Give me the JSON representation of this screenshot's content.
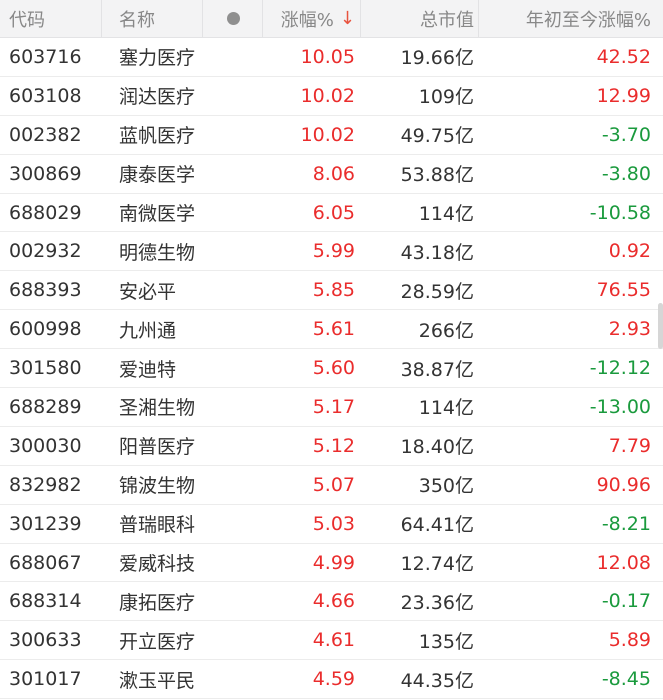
{
  "header": {
    "code": "代码",
    "name": "名称",
    "change": "涨幅%",
    "sort_arrow": "↓",
    "market_cap": "总市值",
    "ytd": "年初至今涨幅%"
  },
  "colors": {
    "up": "#ea2c2c",
    "down": "#1a9a3d",
    "sort_arrow": "#e8533f"
  },
  "rows": [
    {
      "code": "603716",
      "name": "塞力医疗",
      "change": "10.05",
      "cap": "19.66亿",
      "ytd": "42.52",
      "ytd_dir": "up"
    },
    {
      "code": "603108",
      "name": "润达医疗",
      "change": "10.02",
      "cap": "109亿",
      "ytd": "12.99",
      "ytd_dir": "up"
    },
    {
      "code": "002382",
      "name": "蓝帆医疗",
      "change": "10.02",
      "cap": "49.75亿",
      "ytd": "-3.70",
      "ytd_dir": "down"
    },
    {
      "code": "300869",
      "name": "康泰医学",
      "change": "8.06",
      "cap": "53.88亿",
      "ytd": "-3.80",
      "ytd_dir": "down"
    },
    {
      "code": "688029",
      "name": "南微医学",
      "change": "6.05",
      "cap": "114亿",
      "ytd": "-10.58",
      "ytd_dir": "down"
    },
    {
      "code": "002932",
      "name": "明德生物",
      "change": "5.99",
      "cap": "43.18亿",
      "ytd": "0.92",
      "ytd_dir": "up"
    },
    {
      "code": "688393",
      "name": "安必平",
      "change": "5.85",
      "cap": "28.59亿",
      "ytd": "76.55",
      "ytd_dir": "up"
    },
    {
      "code": "600998",
      "name": "九州通",
      "change": "5.61",
      "cap": "266亿",
      "ytd": "2.93",
      "ytd_dir": "up"
    },
    {
      "code": "301580",
      "name": "爱迪特",
      "change": "5.60",
      "cap": "38.87亿",
      "ytd": "-12.12",
      "ytd_dir": "down"
    },
    {
      "code": "688289",
      "name": "圣湘生物",
      "change": "5.17",
      "cap": "114亿",
      "ytd": "-13.00",
      "ytd_dir": "down"
    },
    {
      "code": "300030",
      "name": "阳普医疗",
      "change": "5.12",
      "cap": "18.40亿",
      "ytd": "7.79",
      "ytd_dir": "up"
    },
    {
      "code": "832982",
      "name": "锦波生物",
      "change": "5.07",
      "cap": "350亿",
      "ytd": "90.96",
      "ytd_dir": "up"
    },
    {
      "code": "301239",
      "name": "普瑞眼科",
      "change": "5.03",
      "cap": "64.41亿",
      "ytd": "-8.21",
      "ytd_dir": "down"
    },
    {
      "code": "688067",
      "name": "爱威科技",
      "change": "4.99",
      "cap": "12.74亿",
      "ytd": "12.08",
      "ytd_dir": "up"
    },
    {
      "code": "688314",
      "name": "康拓医疗",
      "change": "4.66",
      "cap": "23.36亿",
      "ytd": "-0.17",
      "ytd_dir": "down"
    },
    {
      "code": "300633",
      "name": "开立医疗",
      "change": "4.61",
      "cap": "135亿",
      "ytd": "5.89",
      "ytd_dir": "up"
    },
    {
      "code": "301017",
      "name": "漱玉平民",
      "change": "4.59",
      "cap": "44.35亿",
      "ytd": "-8.45",
      "ytd_dir": "down"
    }
  ]
}
